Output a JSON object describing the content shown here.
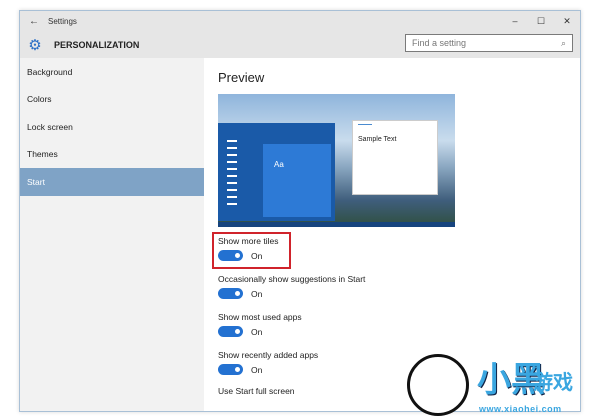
{
  "window": {
    "title": "Settings",
    "minimize": "–",
    "maximize": "☐",
    "close": "✕",
    "back": "←"
  },
  "header": {
    "title": "PERSONALIZATION",
    "search_placeholder": "Find a setting",
    "search_icon": "⌕"
  },
  "sidebar": {
    "items": [
      {
        "label": "Background"
      },
      {
        "label": "Colors"
      },
      {
        "label": "Lock screen"
      },
      {
        "label": "Themes"
      },
      {
        "label": "Start"
      }
    ]
  },
  "main": {
    "title": "Preview",
    "preview": {
      "tile_text": "Aa",
      "sample_text": "Sample Text"
    },
    "options": [
      {
        "label": "Show more tiles",
        "state": "On"
      },
      {
        "label": "Occasionally show suggestions in Start",
        "state": "On"
      },
      {
        "label": "Show most used apps",
        "state": "On"
      },
      {
        "label": "Show recently added apps",
        "state": "On"
      },
      {
        "label": "Use Start full screen"
      }
    ]
  },
  "watermark": {
    "text1": "小黑",
    "text2": "游戏",
    "url": "www.xiaohei.com"
  },
  "colors": {
    "accent": "#2371d1",
    "highlight": "#d0232b"
  }
}
